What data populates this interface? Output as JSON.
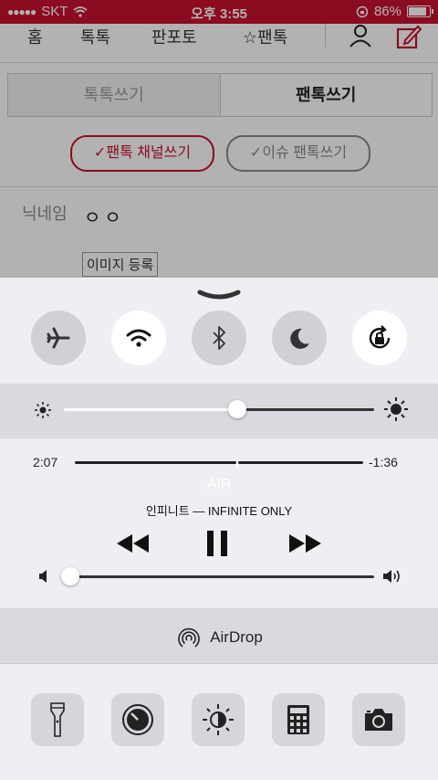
{
  "status": {
    "carrier": "SKT",
    "time": "오후 3:55",
    "battery": "86%"
  },
  "nav": {
    "home": "홈",
    "totok": "톡톡",
    "panpoto": "판포토",
    "pantok": "☆팬톡"
  },
  "tabs": {
    "write_totok": "톡톡쓰기",
    "write_pantok": "팬톡쓰기"
  },
  "buttons": {
    "channel_write": "✓팬톡 채널쓰기",
    "issue_write": "✓이슈 팬톡쓰기",
    "image_register": "이미지 등록"
  },
  "form": {
    "nickname_label": "닉네임",
    "nickname_value": "ㅇㅇ"
  },
  "control_center": {
    "toggles": [
      {
        "name": "airplane-mode",
        "on": false
      },
      {
        "name": "wifi",
        "on": true
      },
      {
        "name": "bluetooth",
        "on": false
      },
      {
        "name": "do-not-disturb",
        "on": false
      },
      {
        "name": "rotation-lock",
        "on": true
      }
    ],
    "brightness": 0.56,
    "music": {
      "elapsed": "2:07",
      "remaining": "-1:36",
      "progress": 0.56,
      "title": "AIR",
      "artist_album": "인피니트 — INFINITE ONLY"
    },
    "volume": 0.02,
    "airdrop_label": "AirDrop",
    "tools": [
      "flashlight",
      "timer",
      "night-shift",
      "calculator",
      "camera"
    ]
  }
}
